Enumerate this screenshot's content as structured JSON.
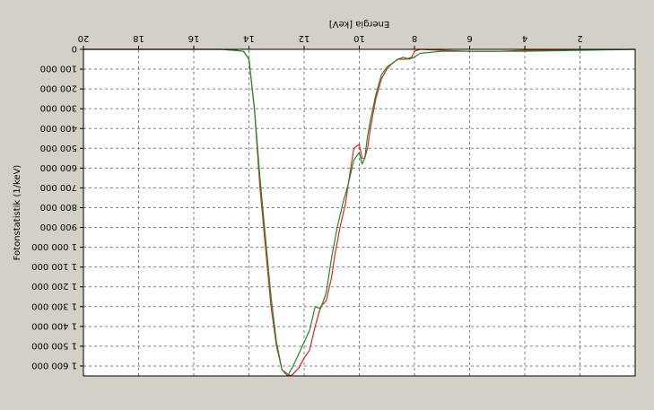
{
  "chart_data": {
    "type": "line",
    "rendered_upside_down": true,
    "xlabel": "Energia [keV]",
    "ylabel": "Fotonstatistik (1/keV)",
    "xlim": [
      0,
      20
    ],
    "ylim": [
      0,
      1650000
    ],
    "x_ticks": [
      2,
      4,
      6,
      8,
      10,
      12,
      14,
      16,
      18,
      20
    ],
    "x_tick_labels": [
      "2",
      "4",
      "6",
      "8",
      "10",
      "12",
      "14",
      "16",
      "18",
      "20"
    ],
    "y_ticks": [
      0,
      100000,
      200000,
      300000,
      400000,
      500000,
      600000,
      700000,
      800000,
      900000,
      1000000,
      1100000,
      1200000,
      1300000,
      1400000,
      1500000,
      1600000
    ],
    "y_tick_labels": [
      "0",
      "100 000",
      "200 000",
      "300 000",
      "400 000",
      "500 000",
      "600 000",
      "700 000",
      "800 000",
      "900 000",
      "1 000 000",
      "1 100 000",
      "1 200 000",
      "1 300 000",
      "1 400 000",
      "1 500 000",
      "1 600 000"
    ],
    "grid": true,
    "background_color": "#d4d0c8",
    "plot_background_color": "#ffffff",
    "series": [
      {
        "color": "#e8231c",
        "x": [
          0,
          4,
          5,
          6,
          7,
          7.8,
          8,
          8.1,
          8.3,
          8.6,
          8.8,
          9.0,
          9.2,
          9.4,
          9.6,
          9.7,
          9.8,
          9.9,
          10.0,
          10.2,
          10.4,
          10.5,
          10.7,
          10.9,
          11.0,
          11.2,
          11.4,
          11.6,
          11.8,
          12.0,
          12.2,
          12.4,
          12.5,
          12.6,
          12.8,
          13.0,
          13.2,
          13.4,
          13.6,
          13.8,
          14.0,
          14.2,
          14.5,
          15,
          20
        ],
        "y": [
          0,
          5000,
          10000,
          10000,
          5000,
          0,
          10000,
          40000,
          50000,
          50000,
          70000,
          100000,
          150000,
          250000,
          400000,
          500000,
          550000,
          550000,
          480000,
          500000,
          680000,
          780000,
          900000,
          1050000,
          1150000,
          1270000,
          1300000,
          1400000,
          1520000,
          1560000,
          1610000,
          1640000,
          1650000,
          1640000,
          1620000,
          1500000,
          1300000,
          1000000,
          700000,
          300000,
          50000,
          10000,
          5000,
          0,
          0
        ]
      },
      {
        "color": "#1a8a2a",
        "x": [
          0,
          4,
          5,
          6,
          7,
          7.8,
          8,
          8.2,
          8.4,
          8.6,
          8.8,
          9.0,
          9.2,
          9.4,
          9.6,
          9.7,
          9.8,
          9.9,
          10.0,
          10.2,
          10.4,
          10.6,
          10.8,
          11.0,
          11.2,
          11.4,
          11.6,
          11.8,
          12.0,
          12.2,
          12.4,
          12.6,
          12.8,
          13.0,
          13.2,
          13.4,
          13.6,
          13.8,
          14.0,
          14.2,
          14.5,
          15,
          20
        ],
        "y": [
          0,
          10000,
          10000,
          10000,
          10000,
          20000,
          40000,
          50000,
          40000,
          50000,
          70000,
          90000,
          130000,
          230000,
          360000,
          440000,
          550000,
          580000,
          520000,
          560000,
          680000,
          780000,
          900000,
          1050000,
          1230000,
          1310000,
          1300000,
          1420000,
          1480000,
          1540000,
          1600000,
          1650000,
          1620000,
          1480000,
          1250000,
          950000,
          650000,
          300000,
          50000,
          10000,
          5000,
          0,
          0
        ]
      }
    ]
  }
}
